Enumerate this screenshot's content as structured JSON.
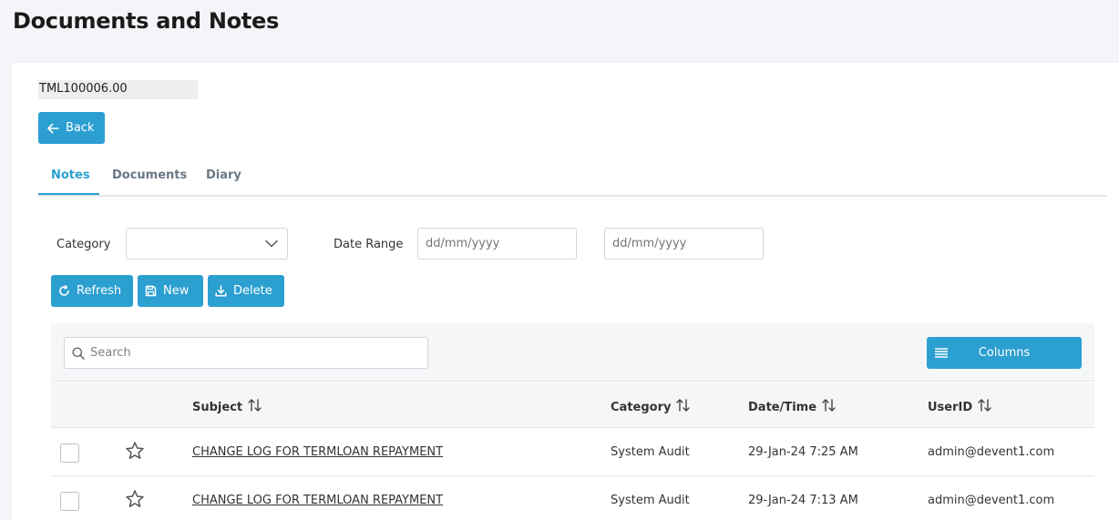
{
  "page": {
    "title": "Documents and Notes"
  },
  "record": {
    "reference": "TML100006.00"
  },
  "buttons": {
    "back": "Back",
    "refresh": "Refresh",
    "new": "New",
    "delete": "Delete",
    "columns": "Columns"
  },
  "tabs": [
    {
      "label": "Notes",
      "active": true
    },
    {
      "label": "Documents",
      "active": false
    },
    {
      "label": "Diary",
      "active": false
    }
  ],
  "filters": {
    "category_label": "Category",
    "category_value": "",
    "date_range_label": "Date Range",
    "date_from_placeholder": "dd/mm/yyyy",
    "date_to_placeholder": "dd/mm/yyyy"
  },
  "search": {
    "placeholder": "Search"
  },
  "table": {
    "columns": [
      "Subject",
      "Category",
      "Date/Time",
      "UserID"
    ],
    "rows": [
      {
        "subject": "CHANGE LOG FOR TERMLOAN REPAYMENT",
        "category": "System Audit",
        "datetime": "29-Jan-24 7:25 AM",
        "userid": "admin@devent1.com"
      },
      {
        "subject": "CHANGE LOG FOR TERMLOAN REPAYMENT",
        "category": "System Audit",
        "datetime": "29-Jan-24 7:13 AM",
        "userid": "admin@devent1.com"
      }
    ]
  },
  "colors": {
    "accent": "#2c9fd1",
    "background": "#f3f5f8",
    "tab_inactive": "#6b7785"
  },
  "icons": [
    "arrow-left-icon",
    "chevron-down-icon",
    "refresh-icon",
    "save-icon",
    "download-icon",
    "search-icon",
    "menu-lines-icon",
    "sort-icon",
    "star-icon"
  ]
}
